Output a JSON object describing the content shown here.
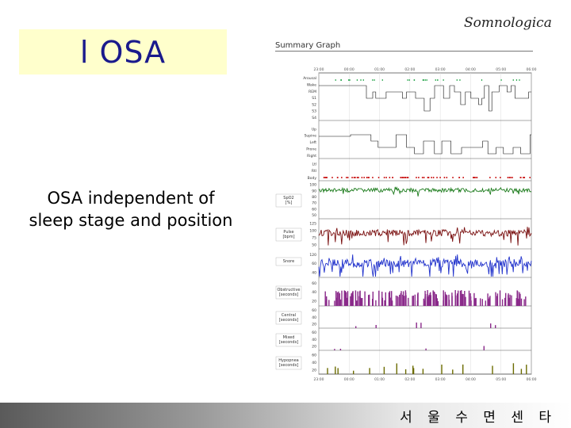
{
  "slide": {
    "title": "l OSA",
    "subtitle_line1": "OSA independent of",
    "subtitle_line2": "sleep stage and position",
    "brand": "Somnologica",
    "summary_title": "Summary Graph",
    "footer": "서 울 수 면 센 타"
  },
  "colors": {
    "title_bg": "#ffffcc",
    "title_text": "#1a1a8c",
    "spo2": "#1a7a1a",
    "pulse": "#7a1010",
    "snore": "#2233cc",
    "events": "#8a2a8a",
    "response": "#6b6b00",
    "arousal_marks": "#33aa55",
    "position_marks": "#cc2222"
  },
  "chart_data": {
    "type": "line",
    "time_ticks": [
      "23:00",
      "00:00",
      "01:00",
      "02:00",
      "03:00",
      "04:00",
      "05:00",
      "06:00"
    ],
    "panels": [
      {
        "key": "hypnogram",
        "labels": [
          "Arousal",
          "Wake",
          "REM",
          "S1",
          "S2",
          "S3",
          "S4"
        ]
      },
      {
        "key": "position",
        "labels": [
          "Up",
          "Supine",
          "Left",
          "Prone",
          "Right"
        ]
      },
      {
        "key": "movement",
        "labels": [
          "Ltl",
          "Rtl",
          "Body"
        ]
      },
      {
        "key": "spo2",
        "label": "SpO2 [%]",
        "ticks": [
          "100",
          "90",
          "80",
          "70",
          "60",
          "50"
        ],
        "ylim": [
          50,
          100
        ]
      },
      {
        "key": "pulse",
        "label": "Pulse [bpm]",
        "ticks": [
          "125",
          "100",
          "75",
          "50"
        ],
        "ylim": [
          50,
          125
        ]
      },
      {
        "key": "snore",
        "label": "Snore",
        "ticks": [
          "120",
          "60",
          "40"
        ]
      },
      {
        "key": "obstructive",
        "label": "Obstructive [seconds]",
        "ticks": [
          "60",
          "40",
          "20"
        ]
      },
      {
        "key": "central",
        "label": "Central [seconds]",
        "ticks": [
          "60",
          "40",
          "20"
        ]
      },
      {
        "key": "mixed",
        "label": "Mixed [seconds]",
        "ticks": [
          "60",
          "40",
          "20"
        ]
      },
      {
        "key": "hypopnea",
        "label": "Hypopnea [seconds]",
        "ticks": [
          "60",
          "40",
          "20"
        ]
      }
    ]
  }
}
